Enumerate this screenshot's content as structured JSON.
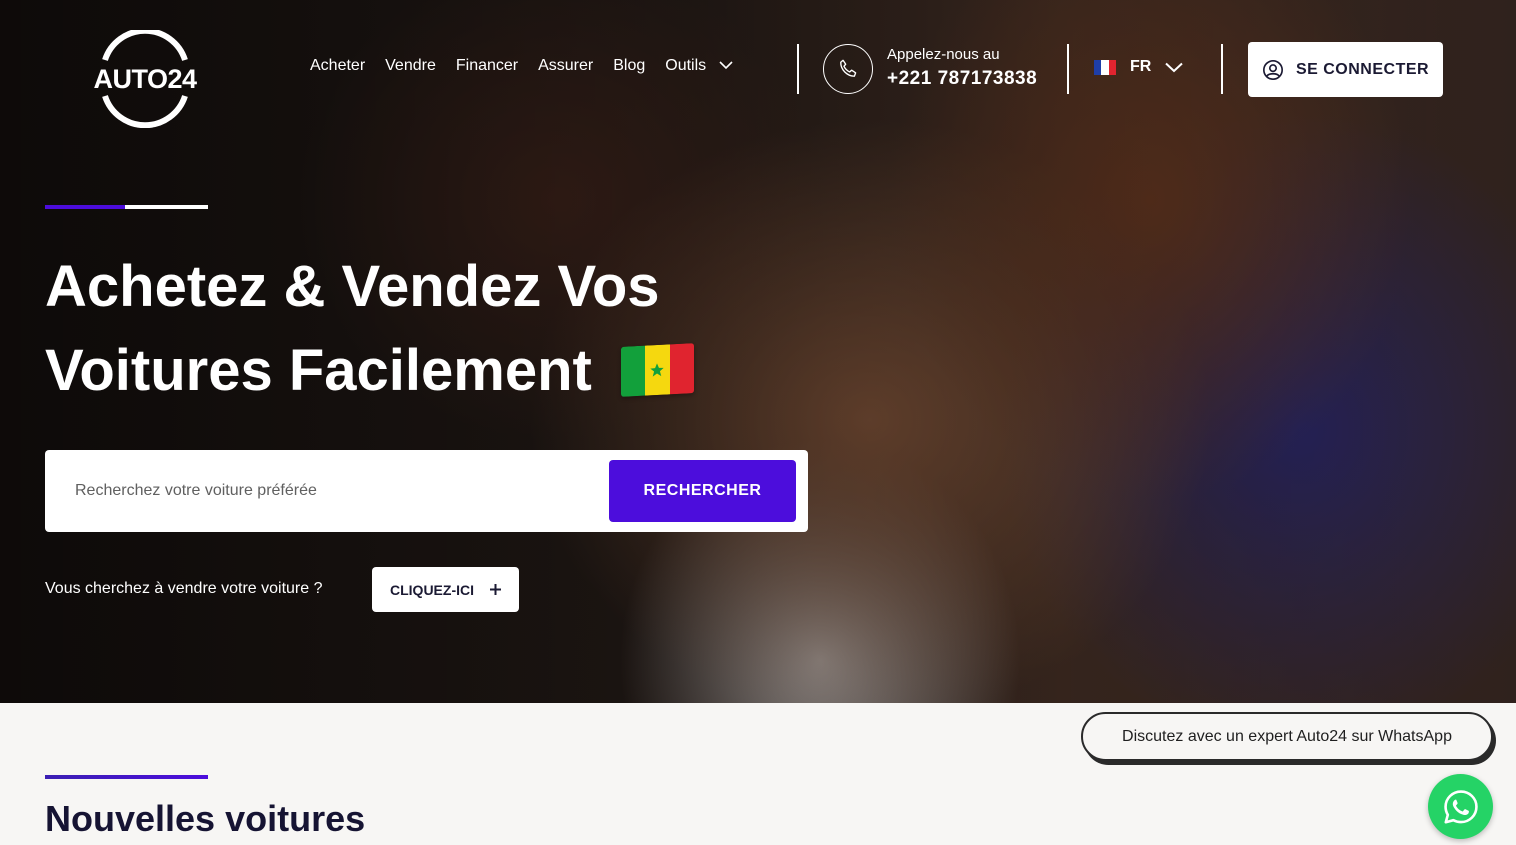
{
  "brand": {
    "logo_text": "AUTO24"
  },
  "nav": {
    "items": [
      {
        "label": "Acheter"
      },
      {
        "label": "Vendre"
      },
      {
        "label": "Financer"
      },
      {
        "label": "Assurer"
      },
      {
        "label": "Blog"
      },
      {
        "label": "Outils"
      }
    ]
  },
  "contact": {
    "label": "Appelez-nous au",
    "phone": "+221 787173838"
  },
  "language": {
    "code": "FR"
  },
  "auth": {
    "login_label": "SE CONNECTER"
  },
  "hero": {
    "title_line1": "Achetez & Vendez Vos",
    "title_line2": "Voitures Facilement",
    "search_placeholder": "Recherchez votre voiture préférée",
    "search_button": "RECHERCHER",
    "sell_prompt": "Vous cherchez à vendre votre voiture ?",
    "sell_button": "CLIQUEZ-ICI"
  },
  "new_cars": {
    "title": "Nouvelles voitures"
  },
  "whatsapp": {
    "bubble_text": "Discutez avec un expert Auto24 sur WhatsApp"
  },
  "colors": {
    "accent": "#4c0ddc",
    "whatsapp": "#25d366",
    "dark_text": "#161433"
  }
}
